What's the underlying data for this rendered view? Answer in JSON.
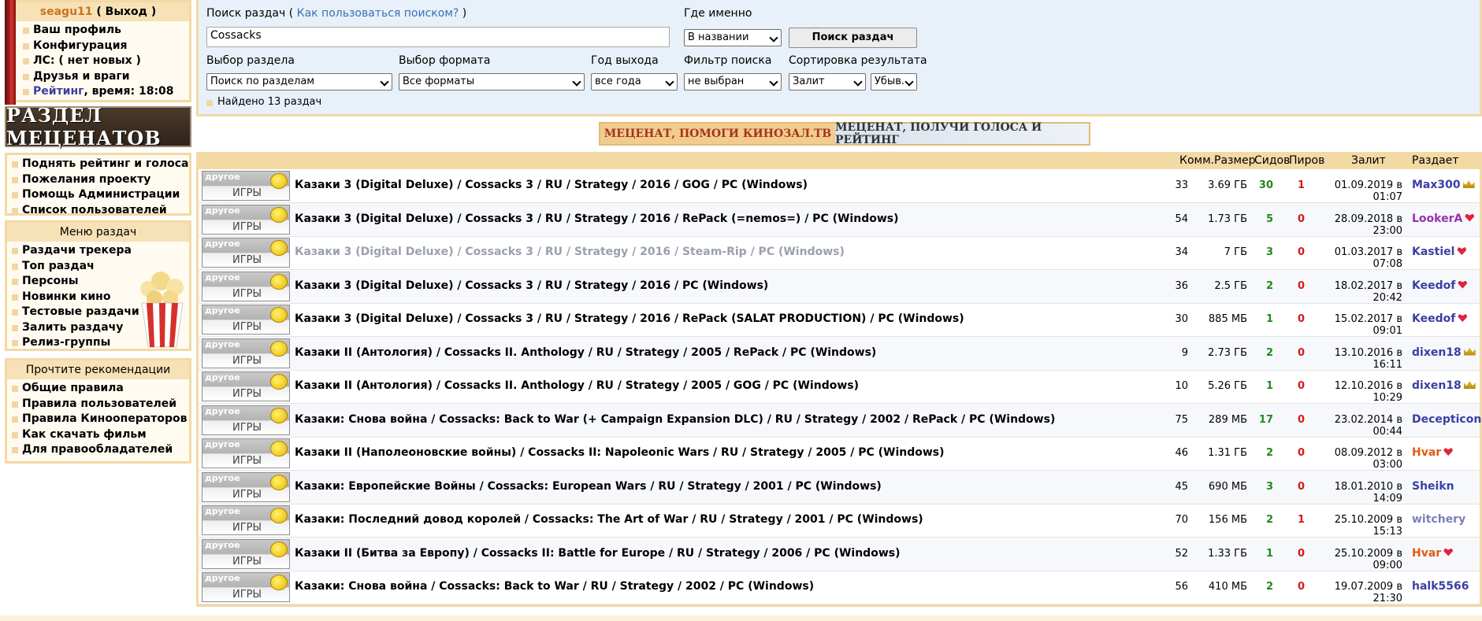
{
  "user": {
    "login": "seagu11",
    "logout": "( Выход )",
    "menu": [
      "Ваш профиль",
      "Конфигурация",
      "ЛС: ( нет новых )",
      "Друзья и враги"
    ],
    "rating_label": "Рейтинг",
    "time_text": ", время: 18:08"
  },
  "sponsors_banner": "РАЗДЕЛ МЕЦЕНАТОВ",
  "links_box": [
    "Поднять рейтинг и голоса",
    "Пожелания проекту",
    "Помощь Администрации",
    "Список пользователей"
  ],
  "menu_box": {
    "title": "Меню раздач",
    "items": [
      "Раздачи трекера",
      "Топ раздач",
      "Персоны",
      "Новинки кино",
      "Тестовые раздачи",
      "Залить раздачу",
      "Релиз-группы"
    ]
  },
  "rules_box": {
    "title": "Прочтите рекомендации",
    "items": [
      "Общие правила",
      "Правила пользователей",
      "Правила Кинооператоров",
      "Как скачать фильм",
      "Для правообладателей"
    ]
  },
  "search": {
    "label": "Поиск раздач",
    "help_open": "( ",
    "help_link": "Как пользоваться поиском?",
    "help_close": " )",
    "query": "Cossacks",
    "where_label": "Где именно",
    "where_value": "В названии",
    "button": "Поиск раздач",
    "section_label": "Выбор раздела",
    "section_value": "Поиск по разделам",
    "format_label": "Выбор формата",
    "format_value": "Все форматы",
    "year_label": "Год выхода",
    "year_value": "все года",
    "filter_label": "Фильтр поиска",
    "filter_value": "не выбран",
    "sort_label": "Сортировка результата",
    "sort_value": "Залит",
    "order_value": "Убыв.",
    "found": "Найдено 13 раздач"
  },
  "promo": {
    "left": "МЕЦЕНАТ, ПОМОГИ КИНОЗАЛ.ТВ",
    "right": "МЕЦЕНАТ, ПОЛУЧИ ГОЛОСА И РЕЙТИНГ"
  },
  "columns": {
    "comments": "Комм.",
    "size": "Размер",
    "seeds": "Сидов",
    "leech": "Пиров",
    "uploaded": "Залит",
    "uploader": "Раздает"
  },
  "category": {
    "top": "другое",
    "bottom": "ИГРЫ"
  },
  "colors": {
    "seeds": "#1e8a1e",
    "leech": "#d41a1a",
    "panel_border": "#f3d9a4",
    "search_bg": "#e8f1f9"
  },
  "rows": [
    {
      "title": "Казаки 3 (Digital Deluxe) / Cossacks 3 / RU / Strategy / 2016 / GOG / PC (Windows)",
      "comments": "33",
      "size": "3.69 ГБ",
      "seeds": "30",
      "leech": "1",
      "date": "01.09.2019 в 01:07",
      "uploader": "Max300",
      "uploader_color": "#3a3fa3",
      "badge": "crown"
    },
    {
      "title": "Казаки 3 (Digital Deluxe) / Cossacks 3 / RU / Strategy / 2016 / RePack (=nemos=) / PC (Windows)",
      "comments": "54",
      "size": "1.73 ГБ",
      "seeds": "5",
      "leech": "0",
      "date": "28.09.2018 в 23:00",
      "uploader": "LookerA",
      "uploader_color": "#9b2fae",
      "badge": "heart"
    },
    {
      "title": "Казаки 3 (Digital Deluxe) / Cossacks 3 / RU / Strategy / 2016 / Steam-Rip / PC (Windows)",
      "comments": "34",
      "size": "7 ГБ",
      "seeds": "3",
      "leech": "0",
      "date": "01.03.2017 в 07:08",
      "uploader": "Kastiel",
      "uploader_color": "#3a3fa3",
      "badge": "heart",
      "grey": true
    },
    {
      "title": "Казаки 3 (Digital Deluxe) / Cossacks 3 / RU / Strategy / 2016 / PC (Windows)",
      "comments": "36",
      "size": "2.5 ГБ",
      "seeds": "2",
      "leech": "0",
      "date": "18.02.2017 в 20:42",
      "uploader": "Keedof",
      "uploader_color": "#3a3fa3",
      "badge": "heart"
    },
    {
      "title": "Казаки 3 (Digital Deluxe) / Cossacks 3 / RU / Strategy / 2016 / RePack (SALAT PRODUCTION) / PC (Windows)",
      "comments": "30",
      "size": "885 МБ",
      "seeds": "1",
      "leech": "0",
      "date": "15.02.2017 в 09:01",
      "uploader": "Keedof",
      "uploader_color": "#3a3fa3",
      "badge": "heart"
    },
    {
      "title": "Казаки II (Антология) / Cossacks II. Anthology / RU / Strategy / 2005 / RePack / PC (Windows)",
      "comments": "9",
      "size": "2.73 ГБ",
      "seeds": "2",
      "leech": "0",
      "date": "13.10.2016 в 16:11",
      "uploader": "dixen18",
      "uploader_color": "#3a3fa3",
      "badge": "crown"
    },
    {
      "title": "Казаки II (Антология) / Cossacks II. Anthology / RU / Strategy / 2005 / GOG / PC (Windows)",
      "comments": "10",
      "size": "5.26 ГБ",
      "seeds": "1",
      "leech": "0",
      "date": "12.10.2016 в 10:29",
      "uploader": "dixen18",
      "uploader_color": "#3a3fa3",
      "badge": "crown"
    },
    {
      "title": "Казаки: Снова война / Cossacks: Back to War (+ Campaign Expansion DLC) / RU / Strategy / 2002 / RePack / PC (Windows)",
      "comments": "75",
      "size": "289 МБ",
      "seeds": "17",
      "leech": "0",
      "date": "23.02.2014 в 00:44",
      "uploader": "Decepticon",
      "uploader_color": "#3a3fa3",
      "badge": "crown"
    },
    {
      "title": "Казаки II (Наполеоновские войны) / Cossacks II: Napoleonic Wars / RU / Strategy / 2005 / PC (Windows)",
      "comments": "46",
      "size": "1.31 ГБ",
      "seeds": "2",
      "leech": "0",
      "date": "08.09.2012 в 03:00",
      "uploader": "Hvar",
      "uploader_color": "#e05a12",
      "badge": "heart"
    },
    {
      "title": "Казаки: Европейские Войны / Cossacks: European Wars / RU / Strategy / 2001 / PC (Windows)",
      "comments": "45",
      "size": "690 МБ",
      "seeds": "3",
      "leech": "0",
      "date": "18.01.2010 в 14:09",
      "uploader": "Sheikn",
      "uploader_color": "#3a3fa3",
      "badge": ""
    },
    {
      "title": "Казаки: Последний довод королей / Cossacks: The Art of War / RU / Strategy / 2001 / PC (Windows)",
      "comments": "70",
      "size": "156 МБ",
      "seeds": "2",
      "leech": "1",
      "date": "25.10.2009 в 15:13",
      "uploader": "witchery",
      "uploader_color": "#7b7fb8",
      "badge": ""
    },
    {
      "title": "Казаки II (Битва за Европу) / Cossacks II: Battle for Europe / RU / Strategy / 2006 / PC (Windows)",
      "comments": "52",
      "size": "1.33 ГБ",
      "seeds": "1",
      "leech": "0",
      "date": "25.10.2009 в 09:00",
      "uploader": "Hvar",
      "uploader_color": "#e05a12",
      "badge": "heart"
    },
    {
      "title": "Казаки: Снова война / Cossacks: Back to War / RU / Strategy / 2002 / PC (Windows)",
      "comments": "56",
      "size": "410 МБ",
      "seeds": "2",
      "leech": "0",
      "date": "19.07.2009 в 21:30",
      "uploader": "halk5566",
      "uploader_color": "#3a3fa3",
      "badge": ""
    }
  ]
}
